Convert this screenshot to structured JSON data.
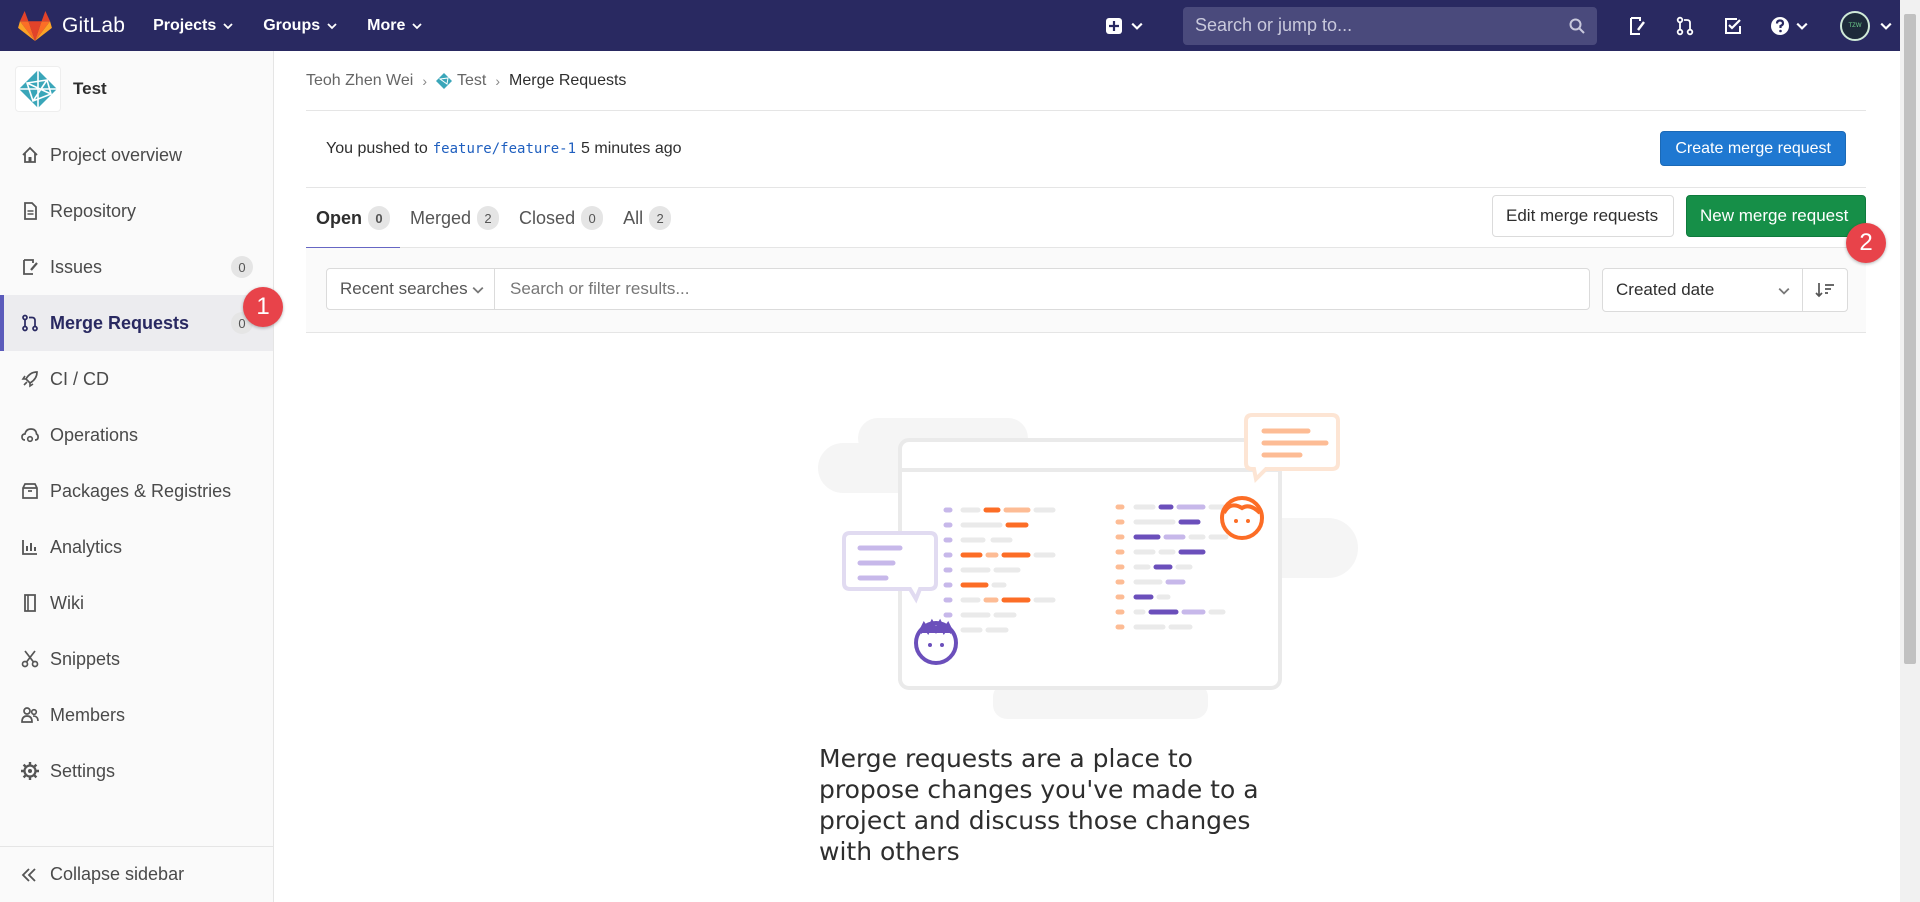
{
  "navbar": {
    "brand": "GitLab",
    "menu": [
      "Projects",
      "Groups",
      "More"
    ],
    "search_placeholder": "Search or jump to...",
    "avatar_text": "TZW"
  },
  "sidebar": {
    "project_name": "Test",
    "items": [
      {
        "label": "Project overview",
        "icon": "home-icon"
      },
      {
        "label": "Repository",
        "icon": "doc-icon"
      },
      {
        "label": "Issues",
        "icon": "issues-icon",
        "count": "0"
      },
      {
        "label": "Merge Requests",
        "icon": "merge-icon",
        "count": "0",
        "active": true
      },
      {
        "label": "CI / CD",
        "icon": "rocket-icon"
      },
      {
        "label": "Operations",
        "icon": "cloud-icon"
      },
      {
        "label": "Packages & Registries",
        "icon": "package-icon"
      },
      {
        "label": "Analytics",
        "icon": "chart-icon"
      },
      {
        "label": "Wiki",
        "icon": "book-icon"
      },
      {
        "label": "Snippets",
        "icon": "scissors-icon"
      },
      {
        "label": "Members",
        "icon": "users-icon"
      },
      {
        "label": "Settings",
        "icon": "gear-icon"
      }
    ],
    "collapse_label": "Collapse sidebar"
  },
  "markers": {
    "one": "1",
    "two": "2"
  },
  "breadcrumb": {
    "owner": "Teoh Zhen Wei",
    "project": "Test",
    "current": "Merge Requests"
  },
  "push": {
    "prefix": "You pushed to",
    "branch": "feature/feature-1",
    "suffix": "5 minutes ago",
    "button": "Create merge request"
  },
  "tabs": [
    {
      "label": "Open",
      "count": "0"
    },
    {
      "label": "Merged",
      "count": "2"
    },
    {
      "label": "Closed",
      "count": "0"
    },
    {
      "label": "All",
      "count": "2"
    }
  ],
  "actions": {
    "edit": "Edit merge requests",
    "new": "New merge request"
  },
  "filter": {
    "recent": "Recent searches",
    "placeholder": "Search or filter results...",
    "sort": "Created date"
  },
  "empty": {
    "text": "Merge requests are a place to propose changes you've made to a project and discuss those changes with others"
  },
  "colors": {
    "navbar": "#292961",
    "primary": "#1f78d1",
    "success": "#168f48",
    "marker": "#e8434a"
  }
}
